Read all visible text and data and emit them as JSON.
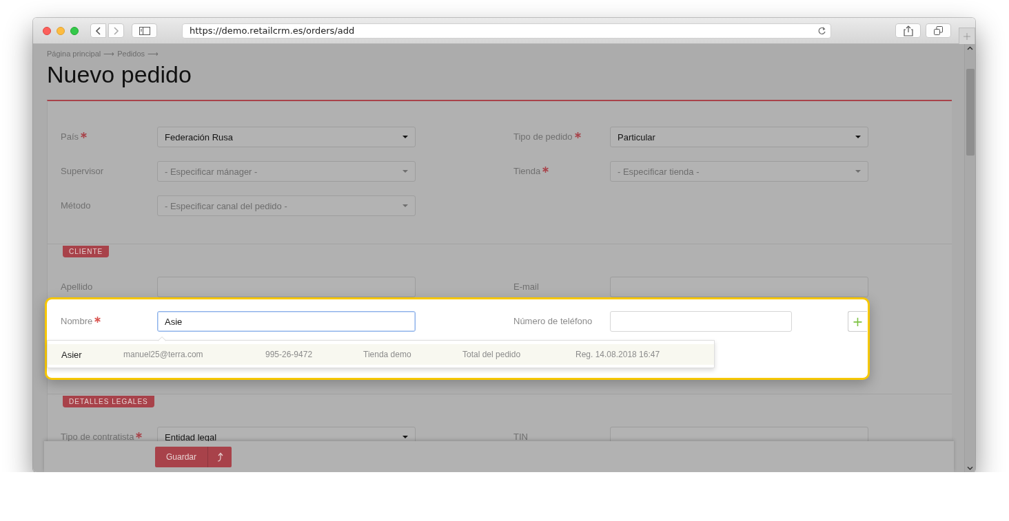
{
  "browser": {
    "url": "https://demo.retailcrm.es/orders/add"
  },
  "breadcrumbs": [
    {
      "label": "Página principal",
      "separator": "⟶"
    },
    {
      "label": "Pedidos",
      "separator": "⟶"
    }
  ],
  "title": "Nuevo pedido",
  "order": {
    "rows": [
      {
        "highlighted": false,
        "left": {
          "label": "País",
          "required": true,
          "kind": "select",
          "value": "Federación Rusa"
        },
        "right": {
          "label": "Tipo de pedido",
          "required": true,
          "kind": "select",
          "value": "Particular"
        }
      },
      {
        "highlighted": false,
        "left": {
          "label": "Supervisor",
          "required": false,
          "kind": "select",
          "placeholder": "- Especificar mánager -"
        },
        "right": {
          "label": "Tienda",
          "required": true,
          "kind": "select",
          "placeholder": "- Especificar tienda -"
        }
      },
      {
        "highlighted": false,
        "left": {
          "label": "Método",
          "required": false,
          "kind": "select",
          "placeholder": "- Especificar canal del pedido -"
        }
      }
    ]
  },
  "sections": [
    {
      "tag": "CLIENTE",
      "rows": [
        {
          "highlighted": false,
          "left": {
            "label": "Apellido",
            "required": false,
            "kind": "input",
            "focused": false
          },
          "right": {
            "label": "E-mail",
            "required": false,
            "kind": "input",
            "focused": false
          }
        },
        {
          "highlighted": true,
          "left": {
            "label": "Nombre",
            "required": true,
            "kind": "input",
            "value": "Asie",
            "focused": true
          },
          "right": {
            "label": "Número de teléfono",
            "required": false,
            "kind": "input",
            "focused": false
          },
          "add_button": "+",
          "suggestions": [
            {
              "selected": true,
              "name": "Asier",
              "email": "manuel25@terra.com",
              "phone": "995-26-9472",
              "store": "Tienda demo",
              "total": "Total del pedido",
              "registered": "Reg. 14.08.2018 16:47"
            }
          ]
        }
      ]
    },
    {
      "tag": "DETALLES LEGALES",
      "rows": [
        {
          "highlighted": false,
          "left": {
            "label": "Tipo de contratista",
            "required": true,
            "kind": "select",
            "value": "Entidad legal"
          },
          "right": {
            "label": "TIN",
            "required": false,
            "kind": "input",
            "focused": false
          }
        }
      ]
    }
  ],
  "save_bar": {
    "button": "Guardar"
  }
}
